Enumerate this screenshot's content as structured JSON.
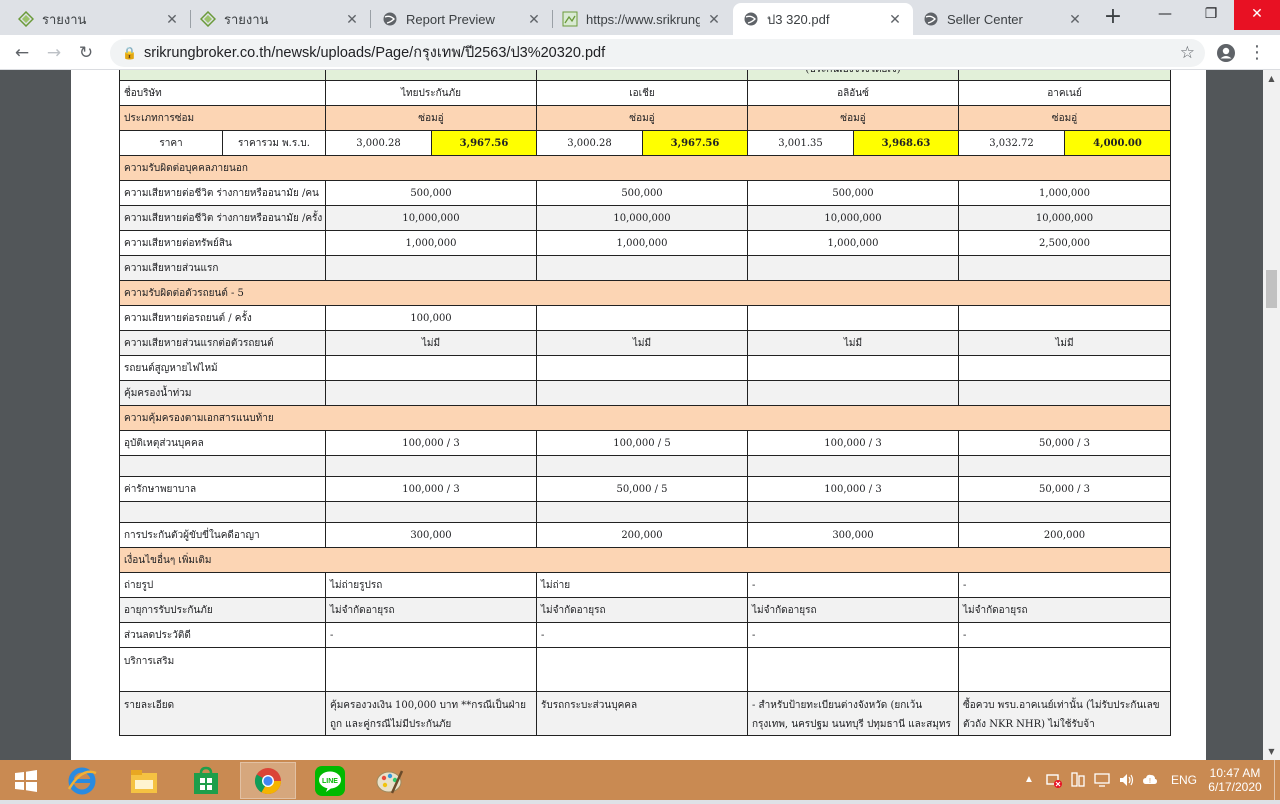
{
  "browser": {
    "tabs": [
      {
        "title": "รายงาน",
        "icon": "grid-logo-icon"
      },
      {
        "title": "รายงาน",
        "icon": "grid-logo-icon"
      },
      {
        "title": "Report Preview",
        "icon": "globe-icon"
      },
      {
        "title": "https://www.srikrungb",
        "icon": "image-icon"
      },
      {
        "title": "ป3 320.pdf",
        "icon": "globe-icon",
        "active": true
      },
      {
        "title": "Seller Center",
        "icon": "globe-icon"
      }
    ],
    "url": "srikrungbroker.co.th/newsk/uploads/Page/กรุงเทพ/ปี2563/ป3%20320.pdf"
  },
  "doc": {
    "top_partial": "(ประกันเองจริงโดยเจ)",
    "company_label": "ชื่อบริษัท",
    "companies": [
      "ไทยประกันภัย",
      "เอเชีย",
      "อลิอันซ์",
      "อาคเนย์"
    ],
    "repair_type_label": "ประเภทการซ่อม",
    "repair_types": [
      "ซ่อมอู่",
      "ซ่อมอู่",
      "ซ่อมอู่",
      "ซ่อมอู่"
    ],
    "price_label": "ราคา",
    "price_total_label": "ราคารวม พ.ร.บ.",
    "prices": [
      {
        "base": "3,000.28",
        "total": "3,967.56"
      },
      {
        "base": "3,000.28",
        "total": "3,967.56"
      },
      {
        "base": "3,001.35",
        "total": "3,968.63"
      },
      {
        "base": "3,032.72",
        "total": "4,000.00"
      }
    ],
    "sec_third_party": "ความรับผิดต่อบุคคลภายนอก",
    "rows_third_party": [
      {
        "label": "ความเสียหายต่อชีวิต ร่างกายหรืออนามัย /คน",
        "values": [
          "500,000",
          "500,000",
          "500,000",
          "1,000,000"
        ]
      },
      {
        "label": "ความเสียหายต่อชีวิต ร่างกายหรืออนามัย /ครั้ง",
        "values": [
          "10,000,000",
          "10,000,000",
          "10,000,000",
          "10,000,000"
        ]
      },
      {
        "label": "ความเสียหายต่อทรัพย์สิน",
        "values": [
          "1,000,000",
          "1,000,000",
          "1,000,000",
          "2,500,000"
        ]
      },
      {
        "label": "ความเสียหายส่วนแรก",
        "values": [
          "",
          "",
          "",
          ""
        ]
      }
    ],
    "sec_vehicle": "ความรับผิดต่อตัวรถยนต์ - 5",
    "rows_vehicle": [
      {
        "label": "ความเสียหายต่อรถยนต์ / ครั้ง",
        "values": [
          "100,000",
          "",
          "",
          ""
        ]
      },
      {
        "label": "ความเสียหายส่วนแรกต่อตัวรถยนต์",
        "values": [
          "ไม่มี",
          "ไม่มี",
          "ไม่มี",
          "ไม่มี"
        ]
      },
      {
        "label": "รถยนต์สูญหายไฟไหม้",
        "values": [
          "",
          "",
          "",
          ""
        ]
      },
      {
        "label": "คุ้มครองน้ำท่วม",
        "values": [
          "",
          "",
          "",
          ""
        ]
      }
    ],
    "sec_attach": "ความคุ้มครองตามเอกสารแนบท้าย",
    "rows_attach": [
      {
        "label": "อุบัติเหตุส่วนบุคคล",
        "values": [
          "100,000 / 3",
          "100,000 / 5",
          "100,000 / 3",
          "50,000 / 3"
        ]
      },
      {
        "label": "ค่ารักษาพยาบาล",
        "values": [
          "100,000 / 3",
          "50,000 / 5",
          "100,000 / 3",
          "50,000 / 3"
        ]
      },
      {
        "label": "การประกันตัวผู้ขับขี่ในคดีอาญา",
        "values": [
          "300,000",
          "200,000",
          "300,000",
          "200,000"
        ]
      }
    ],
    "sec_other": "เงื่อนไขอื่นๆ เพิ่มเติม",
    "rows_other": [
      {
        "label": "ถ่ายรูป",
        "values": [
          "ไม่ถ่ายรูปรถ",
          "ไม่ถ่าย",
          "-",
          "-"
        ]
      },
      {
        "label": "อายุการรับประกันภัย",
        "values": [
          "ไม่จำกัดอายุรถ",
          "ไม่จำกัดอายุรถ",
          "ไม่จำกัดอายุรถ",
          "ไม่จำกัดอายุรถ"
        ]
      },
      {
        "label": "ส่วนลดประวัติดี",
        "values": [
          "-",
          "-",
          "-",
          "-"
        ]
      },
      {
        "label": "บริการเสริม",
        "values": [
          "",
          "",
          "",
          ""
        ]
      }
    ],
    "detail_label": "รายละเอียด",
    "details": [
      "คุ้มครองวงเงิน 100,000 บาท **กรณีเป็นฝ่ายถูก และคู่กรณีไม่มีประกันภัย",
      "รับรถกระบะส่วนบุคคล",
      "- สำหรับป้ายทะเบียนต่างจังหวัด (ยกเว้น กรุงเทพ, นครปฐม นนทบุรี ปทุมธานี และสมุทร",
      "ซื้อควบ พรบ.อาคเนย์เท่านั้น (ไม่รับประกันเลขตัวถัง NKR NHR) ไม่ใช้รับจ้า"
    ]
  },
  "taskbar": {
    "lang": "ENG",
    "time": "10:47 AM",
    "date": "6/17/2020"
  }
}
